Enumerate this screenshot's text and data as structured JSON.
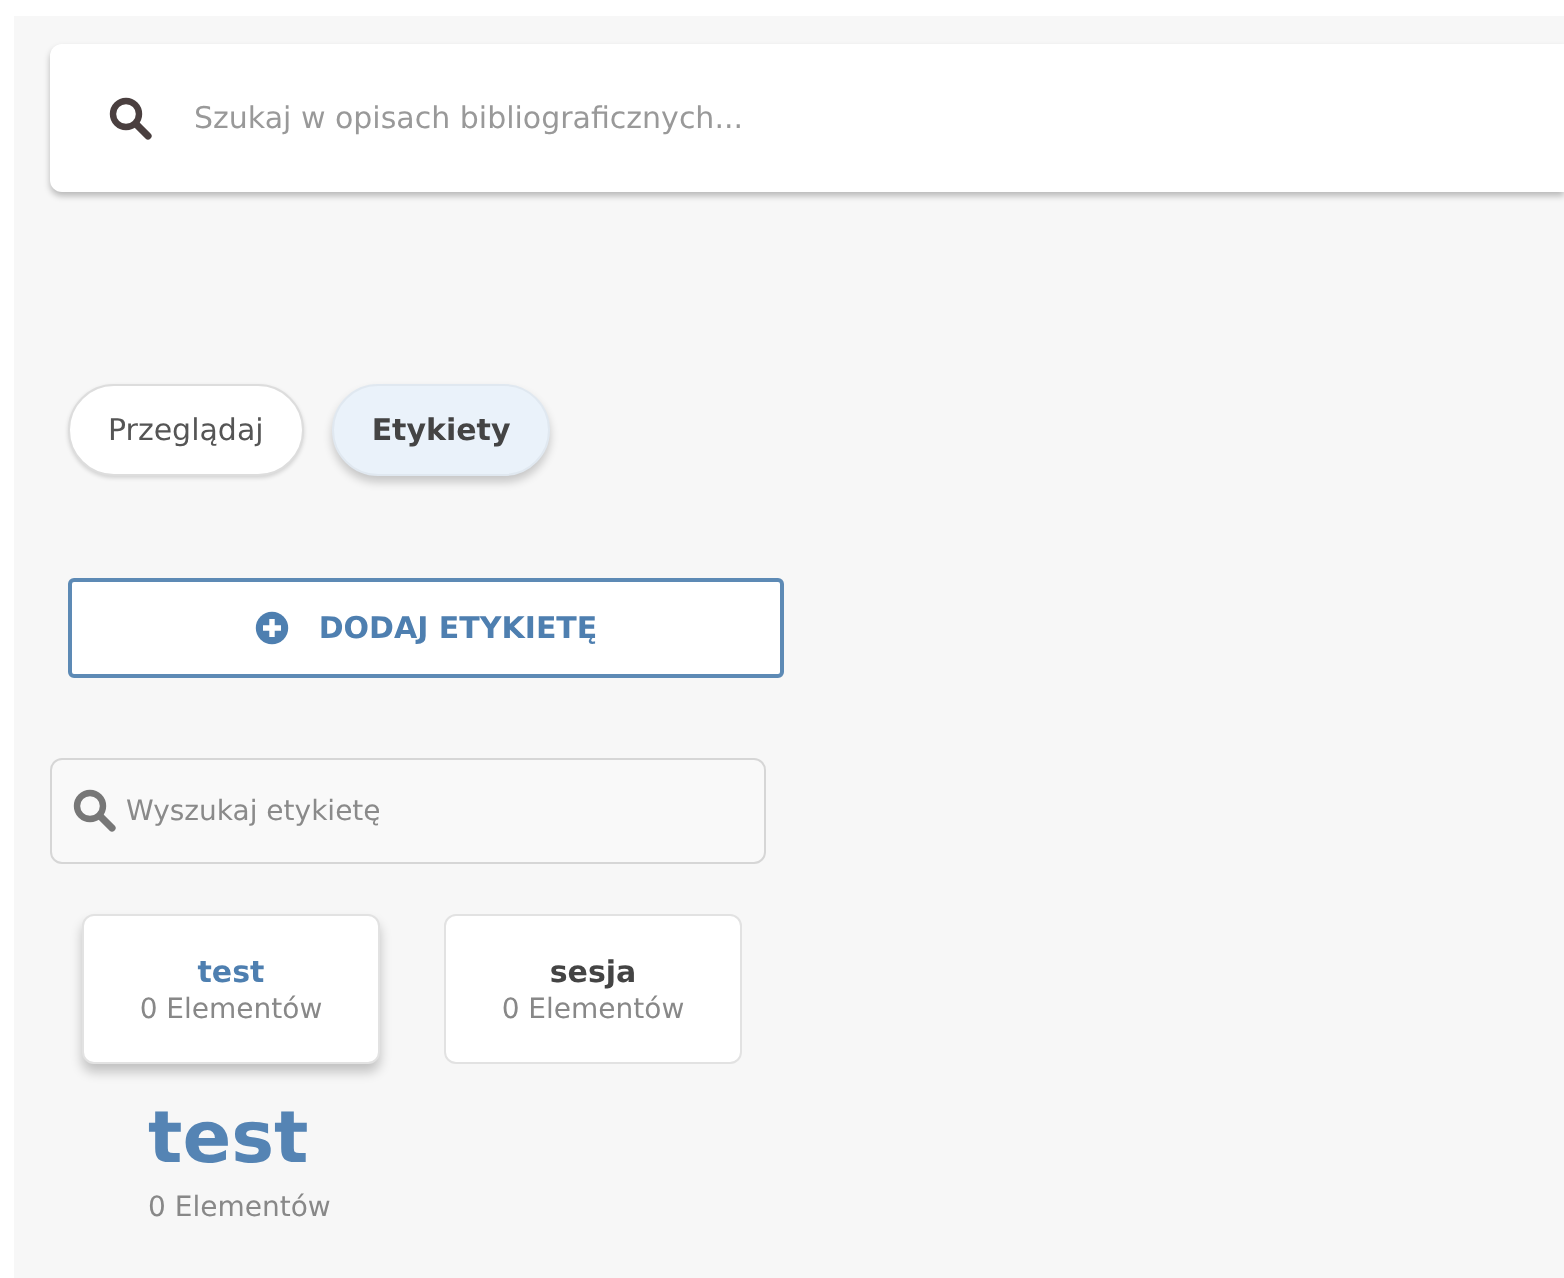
{
  "search": {
    "placeholder": "Szukaj w opisach bibliograficznych..."
  },
  "tabs": [
    {
      "label": "Przeglądaj",
      "selected": false
    },
    {
      "label": "Etykiety",
      "selected": true
    }
  ],
  "add_button": {
    "label": "DODAJ ETYKIETĘ"
  },
  "tag_search": {
    "placeholder": "Wyszukaj etykietę"
  },
  "tags": [
    {
      "name": "test",
      "count": "0 Elementów",
      "selected": true
    },
    {
      "name": "sesja",
      "count": "0 Elementów",
      "selected": false
    }
  ],
  "detail": {
    "title": "test",
    "count": "0 Elementów"
  }
}
